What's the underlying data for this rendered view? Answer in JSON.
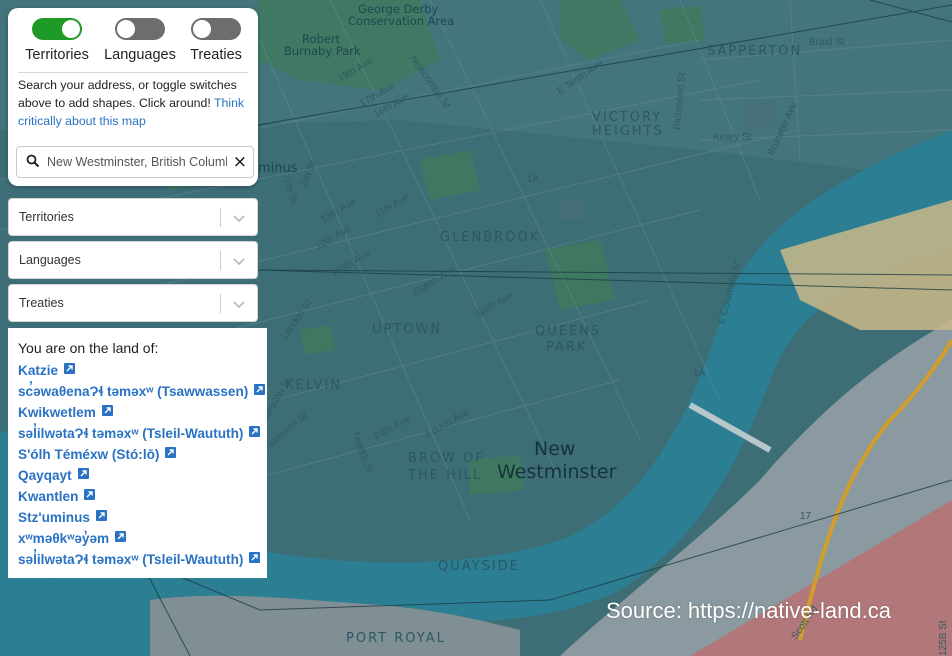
{
  "toggles": [
    {
      "label": "Territories",
      "on": true
    },
    {
      "label": "Languages",
      "on": false
    },
    {
      "label": "Treaties",
      "on": false
    }
  ],
  "help": {
    "text": "Search your address, or toggle switches above to add shapes. Click around! ",
    "link": "Think critically about this map"
  },
  "search": {
    "value": "New Westminster, British Columbia",
    "icon": "search-icon",
    "clear_label": "×"
  },
  "dropdowns": [
    {
      "label": "Territories"
    },
    {
      "label": "Languages"
    },
    {
      "label": "Treaties"
    }
  ],
  "land": {
    "title": "You are on the land of:",
    "items": [
      "Katzie",
      "sc̓əwaθenaɁɬ təməxʷ (Tsawwassen)",
      "Kwikwetlem",
      "səl̓ilwətaɁɬ təməxʷ (Tsleil-Waututh)",
      "S'ólh Téméxw (Stó:lō)",
      "Qayqayt",
      "Kwantlen",
      "Stz'uminus",
      "xʷməθkʷəy̓əm",
      "səl̓ilwətaɁɬ təməxʷ (Tsleil-Waututh)"
    ]
  },
  "map": {
    "city": [
      "New",
      "Westminster"
    ],
    "neighbourhoods": [
      "SAPPERTON",
      "VICTORY",
      "HEIGHTS",
      "GLENBROOK",
      "UPTOWN",
      "QUEENS",
      "PARK",
      "KELVIN",
      "BROW OF",
      "THE HILL",
      "QUAYSIDE",
      "PORT ROYAL"
    ],
    "parks": [
      "George Derby",
      "Conservation Area",
      "Robert",
      "Burnaby Park"
    ],
    "streets": [
      "Braid St",
      "19th Ave",
      "17th Ave",
      "16th Ave",
      "Newcombe St",
      "E Tenth Ave",
      "Richmond St",
      "Keary St",
      "Brunette Ave",
      "6th St",
      "7th St",
      "13th Ave",
      "12th Ave",
      "11th Ave",
      "Tenth Ave",
      "Eighth Ave",
      "Sixth Ave",
      "E Columbia St",
      "London St",
      "Fifth Ave",
      "Fourth Ave",
      "Twelfth St",
      "Nanaimo St",
      "Hamilton St",
      "Scott Rd",
      "125B St"
    ],
    "highways": [
      "1A",
      "1A",
      "17"
    ],
    "partial_label": "minus"
  },
  "source": "Source: https://native-land.ca"
}
